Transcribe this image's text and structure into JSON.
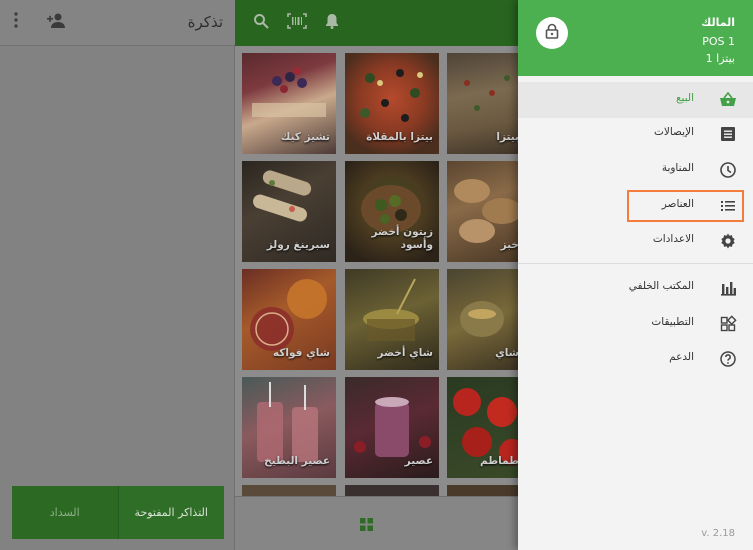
{
  "colors": {
    "brand_green": "#4caf50",
    "active_green": "#43a047",
    "highlight_orange": "#f47c3c"
  },
  "ticket": {
    "title": "تذكرة",
    "icons": [
      "more-vert-icon",
      "add-customer-icon"
    ],
    "open_tickets_label": "التذاكر المفتوحة",
    "charge_label": "السداد"
  },
  "items_grid": {
    "header_icons": [
      "search-icon",
      "barcode-icon",
      "bell-icon"
    ],
    "tiles": [
      {
        "name": "تشيز كيك"
      },
      {
        "name": "بيتزا بالمقلاة"
      },
      {
        "name": "بيتزا"
      },
      {
        "name": "سبرينغ رولز"
      },
      {
        "name": "زيتون أخضر وأسود"
      },
      {
        "name": "خبز"
      },
      {
        "name": "شاي فواكه"
      },
      {
        "name": "شاي أخضر"
      },
      {
        "name": "شاي"
      },
      {
        "name": "عصير البطيخ"
      },
      {
        "name": "عصير"
      },
      {
        "name": "طماطم"
      }
    ],
    "bottom_icon": "grid-icon"
  },
  "drawer": {
    "owner": "المالك",
    "pos": "POS 1",
    "store": "بيتزا 1",
    "menu": [
      {
        "label": "البيع",
        "icon": "basket-icon",
        "active": true
      },
      {
        "label": "الإيصالات",
        "icon": "receipt-icon"
      },
      {
        "label": "المناوبة",
        "icon": "clock-icon"
      },
      {
        "label": "العناصر",
        "icon": "list-icon",
        "highlighted": true
      },
      {
        "label": "الاعدادات",
        "icon": "gear-icon"
      },
      {
        "label": "المكتب الخلفي",
        "icon": "bar-chart-icon"
      },
      {
        "label": "التطبيقات",
        "icon": "apps-icon"
      },
      {
        "label": "الدعم",
        "icon": "help-icon"
      }
    ],
    "version": "v. 2.18"
  }
}
